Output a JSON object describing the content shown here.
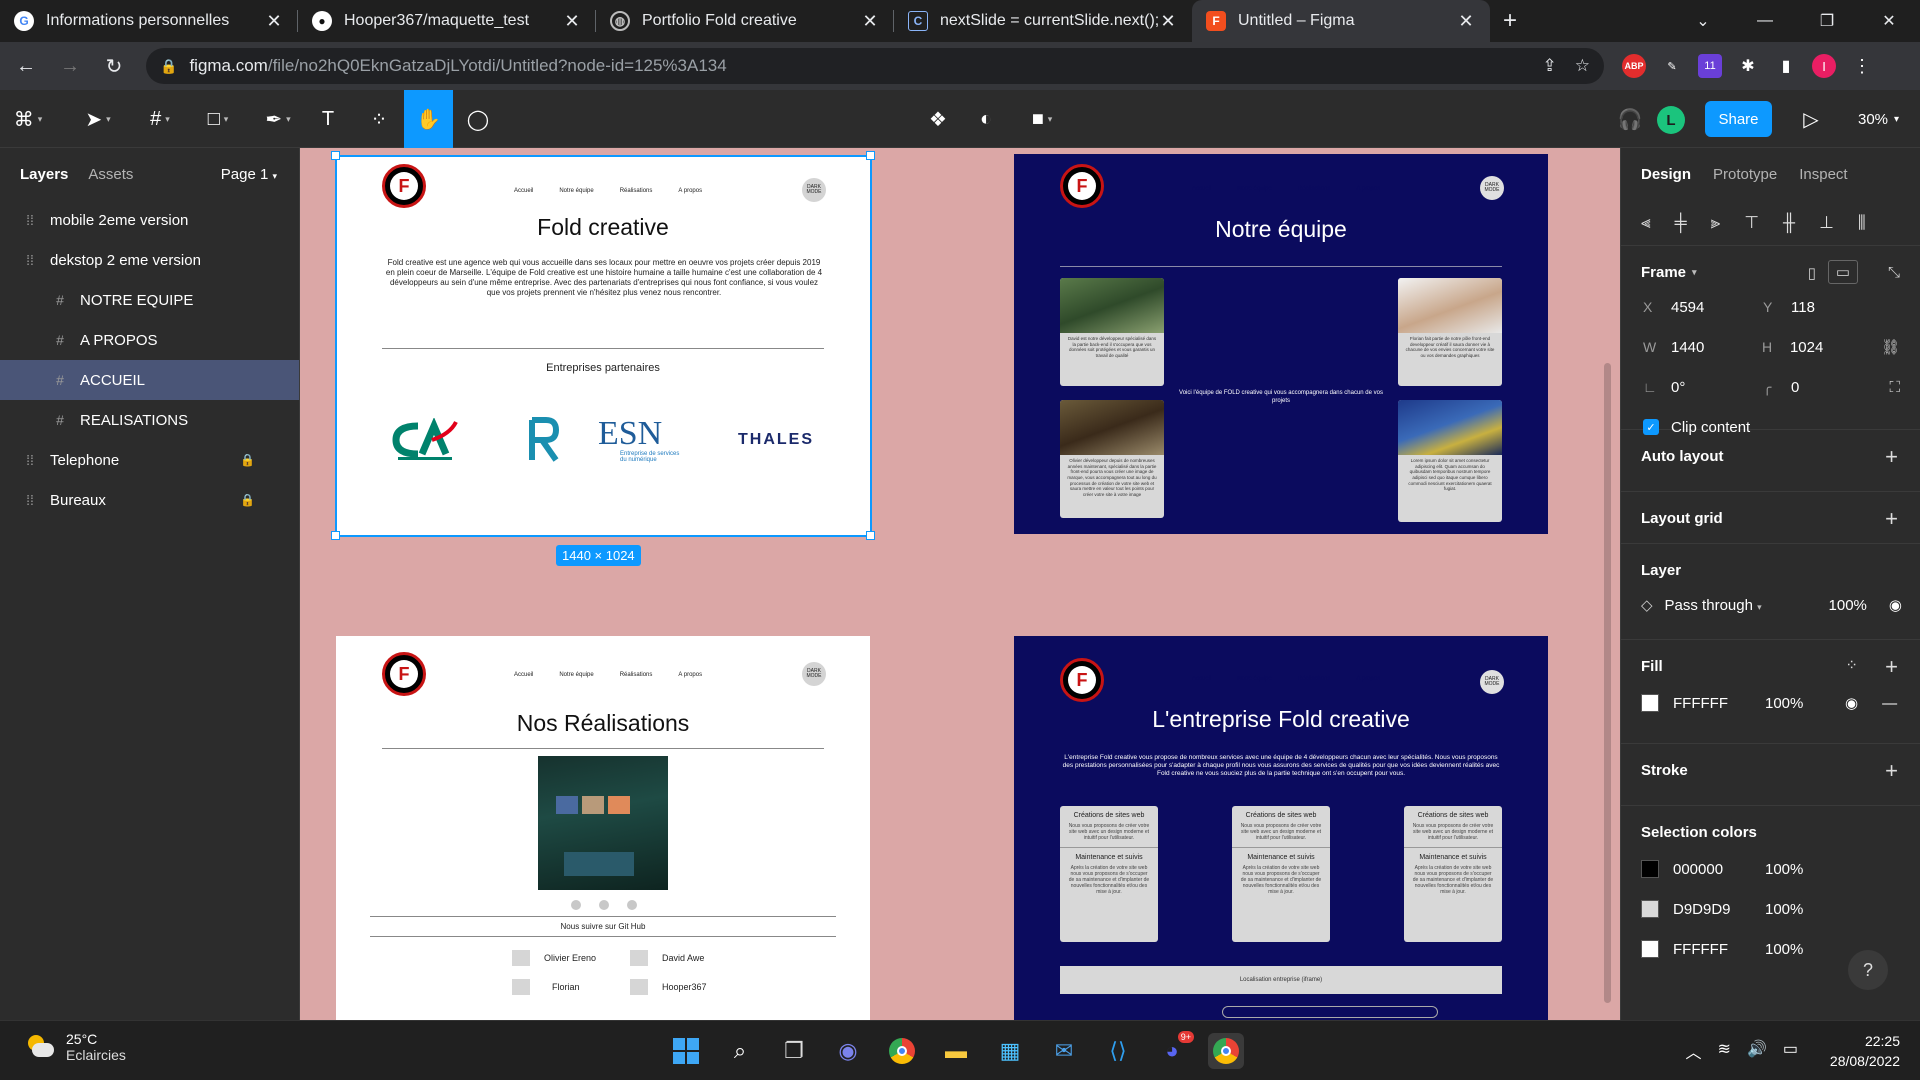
{
  "browser": {
    "tabs": [
      {
        "title": "Informations personnelles",
        "favicon": "google-icon",
        "active": false
      },
      {
        "title": "Hooper367/maquette_test",
        "favicon": "github-icon",
        "active": false
      },
      {
        "title": "Portfolio Fold creative",
        "favicon": "globe-icon",
        "active": false
      },
      {
        "title": "nextSlide = currentSlide.next(); | C",
        "favicon": "codepen-icon",
        "active": false
      },
      {
        "title": "Untitled – Figma",
        "favicon": "figma-icon",
        "active": true
      }
    ],
    "url_host": "figma.com",
    "url_path": "/file/no2hQ0EknGatzaDjLYotdi/Untitled?node-id=125%3A134",
    "ext_badge": "11",
    "profile_initial": "I"
  },
  "figma": {
    "share_label": "Share",
    "avatar_initial": "L",
    "zoom": "30%",
    "left_tabs": {
      "layers": "Layers",
      "assets": "Assets",
      "page": "Page 1"
    },
    "layers": [
      {
        "name": "mobile 2eme version",
        "type": "frame-group",
        "indent": 0,
        "locked": false,
        "selected": false
      },
      {
        "name": "dekstop 2 eme version",
        "type": "frame-group",
        "indent": 0,
        "locked": false,
        "selected": false
      },
      {
        "name": "NOTRE EQUIPE",
        "type": "frame",
        "indent": 1,
        "locked": false,
        "selected": false
      },
      {
        "name": "A PROPOS",
        "type": "frame",
        "indent": 1,
        "locked": false,
        "selected": false
      },
      {
        "name": "ACCUEIL",
        "type": "frame",
        "indent": 1,
        "locked": false,
        "selected": true
      },
      {
        "name": "REALISATIONS",
        "type": "frame",
        "indent": 1,
        "locked": false,
        "selected": false
      },
      {
        "name": "Telephone",
        "type": "frame-group",
        "indent": 0,
        "locked": true,
        "selected": false
      },
      {
        "name": "Bureaux",
        "type": "frame-group",
        "indent": 0,
        "locked": true,
        "selected": false
      }
    ],
    "right": {
      "tabs": [
        "Design",
        "Prototype",
        "Inspect"
      ],
      "frame_label": "Frame",
      "x": "4594",
      "y": "118",
      "w": "1440",
      "h": "1024",
      "rotation": "0°",
      "radius": "0",
      "clip_content": "Clip content",
      "auto_layout": "Auto layout",
      "layout_grid": "Layout grid",
      "layer_title": "Layer",
      "layer_mode": "Pass through",
      "layer_opacity": "100%",
      "fill_title": "Fill",
      "fill_hex": "FFFFFF",
      "fill_opacity": "100%",
      "stroke_title": "Stroke",
      "selection_colors_title": "Selection colors",
      "selection_colors": [
        {
          "hex": "000000",
          "opacity": "100%",
          "color": "#000000"
        },
        {
          "hex": "D9D9D9",
          "opacity": "100%",
          "color": "#D9D9D9"
        },
        {
          "hex": "FFFFFF",
          "opacity": "100%",
          "color": "#FFFFFF"
        }
      ]
    },
    "size_badge": "1440 × 1024"
  },
  "frames": {
    "nav": [
      "Accueil",
      "Notre équipe",
      "Réalisations",
      "A propos"
    ],
    "dark_mode": "DARK MODE",
    "accueil": {
      "title": "Fold creative",
      "paragraph": "Fold creative est une agence web qui vous accueille dans ses locaux pour mettre en oeuvre vos projets créer depuis 2019 en plein coeur de Marseille. L'équipe de Fold creative est une histoire humaine a taille humaine c'est une collaboration de 4 développeurs au sein d'une même entreprise. Avec des partenariats d'entreprises qui nous font confiance, si vous voulez que vos projets prennent vie n'hésitez plus venez nous rencontrer.",
      "partners_title": "Entreprises partenaires",
      "partners": [
        "CA",
        "R",
        "ESN",
        "THALES"
      ],
      "esn_sub": "Entreprise de services du numérique"
    },
    "equipe": {
      "title": "Notre équipe",
      "center_text": "Voici l'équipe de FOLD creative qui vous accompagnera dans chacun de vos projets",
      "cards": [
        "David est notre développeur spécialisé dans la partie back-end il s'occupera que vos données soit protégées et vous garantis un travail de qualité",
        "Florian fait partie de notre pôle front-end developpeur créatif il saura donner vie à chacune de vos envies concernant votre site ou vos demandes graphiques",
        "Olivier développeur depuis de nombreuses années maintenant, spécialisé dans la partie front-end pourra vous créer une image de marque, vous accompagnera tout au long du processus de création de votre site web et saura mettre en valeur tout les points pour créer votre site à votre image",
        "Lorem ipsum dolor sit amet consectetur adipiscing elit. Quam accumsan do quibusdam temporibus nostrum tempore adipisci sed quo itaque cumque libero commodi nesciunt exercitationem quaerat fugiat."
      ]
    },
    "realisations": {
      "title": "Nos Réalisations",
      "github_label": "Nous suivre sur Git Hub",
      "people": [
        "Olivier Ereno",
        "David Awe",
        "Florian",
        "Hooper367"
      ]
    },
    "apropos": {
      "title": "L'entreprise Fold creative",
      "paragraph": "L'entreprise Fold creative vous propose de nombreux services avec une équipe de 4 développeurs chacun avec leur spécialités. Nous vous proposons des prestations personnalisées pour s'adapter à chaque profil nous vous assurons des services de qualités pour que vos idées deviennent réalités avec Fold creative ne vous souciez plus de la partie technique ont s'en occupent pour vous.",
      "service_title": "Créations de sites web",
      "service_text": "Nous vous proposons de créer votre site web avec un design moderne et intuitif pour l'utilisateur.",
      "maint_title": "Maintenance et suivis",
      "maint_text": "Après la création de votre site web nous vous proposons de s'occuper de sa maintenance et d'implanter de nouvelles fonctionnalités et/ou des mise à jour.",
      "location_label": "Localisation entreprise (iframe)"
    }
  },
  "taskbar": {
    "temp": "25°C",
    "weather": "Eclaircies",
    "time": "22:25",
    "date": "28/08/2022",
    "discord_badge": "9+"
  }
}
